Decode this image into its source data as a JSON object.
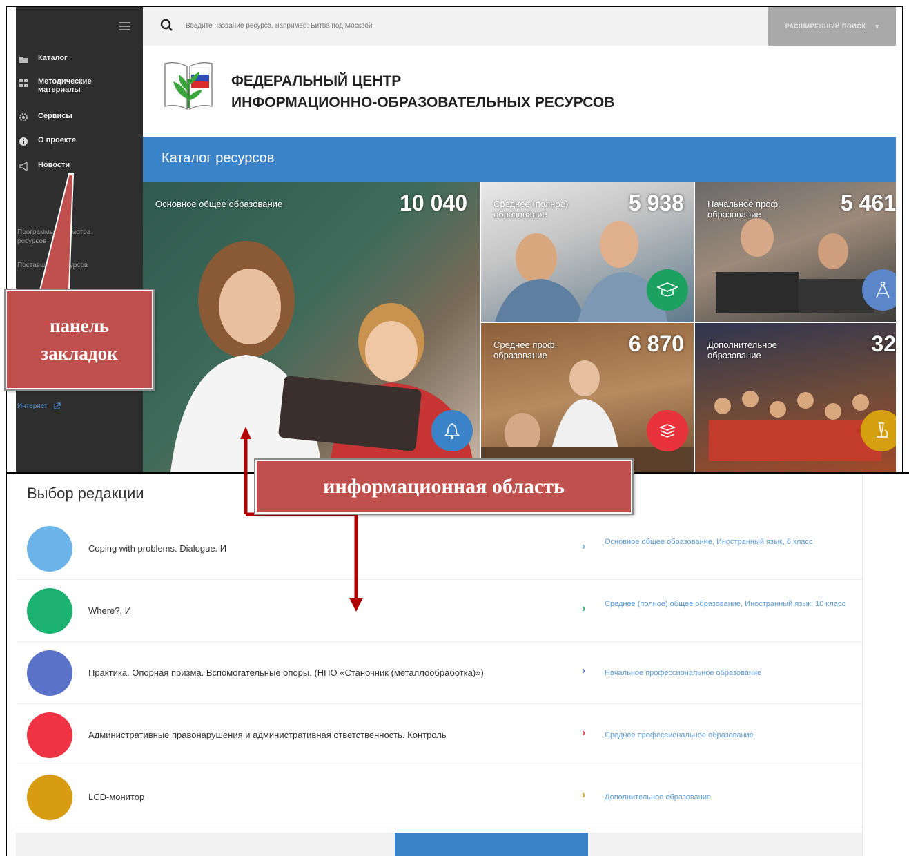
{
  "sidebar": {
    "items": [
      {
        "label": "Каталог",
        "icon": "folder-icon"
      },
      {
        "label": "Методические материалы",
        "icon": "grid-icon"
      },
      {
        "label": "Сервисы",
        "icon": "gear-icon"
      },
      {
        "label": "О проекте",
        "icon": "info-icon"
      },
      {
        "label": "Новости",
        "icon": "megaphone-icon"
      }
    ],
    "links": [
      "Программы просмотра ресурсов",
      "Поставщики ресурсов"
    ],
    "external_link": "Интернет"
  },
  "search": {
    "placeholder": "Введите название ресурса, например: Битва под Москвой",
    "advanced_label": "РАСШИРЕННЫЙ ПОИСК"
  },
  "header": {
    "title_line1": "ФЕДЕРАЛЬНЫЙ ЦЕНТР",
    "title_line2": "ИНФОРМАЦИОННО-ОБРАЗОВАТЕЛЬНЫХ РЕСУРСОВ"
  },
  "catalog": {
    "title": "Каталог ресурсов",
    "tiles": [
      {
        "label": "Основное общее образование",
        "count": "10 040",
        "color": "#3b83c8",
        "icon": "bell-icon"
      },
      {
        "label": "Среднее (полное) образование",
        "count": "5 938",
        "color": "#1ca160",
        "icon": "graduation-cap-icon"
      },
      {
        "label": "Начальное проф. образование",
        "count": "5 461",
        "color": "#5b86c9",
        "icon": "compass-icon"
      },
      {
        "label": "Среднее проф. образование",
        "count": "6 870",
        "color": "#e8323c",
        "icon": "books-icon"
      },
      {
        "label": "Дополнительное образование",
        "count": "32",
        "color": "#d4a010",
        "icon": "microscope-icon"
      }
    ]
  },
  "editor_choice": {
    "title": "Выбор редакции",
    "rows": [
      {
        "title": "Coping with problems. Dialogue. И",
        "category": "Основное общее образование, Иностранный язык, 6 класс",
        "color": "#6cb3ea"
      },
      {
        "title": "Where?. И",
        "category": "Среднее (полное) общее образование, Иностранный язык, 10 класс",
        "color": "#1db272"
      },
      {
        "title": "Практика. Опорная призма. Вспомогательные опоры. (НПО «Станочник (металлообработка)»)",
        "category": "Начальное профессиональное образование",
        "color": "#5b72c9"
      },
      {
        "title": "Административные правонарушения и административная ответственность. Контроль",
        "category": "Среднее профессиональное образование",
        "color": "#ef3344"
      },
      {
        "title": "LCD-монитор",
        "category": "Дополнительное образование",
        "color": "#d89c12"
      }
    ]
  },
  "annotations": {
    "bookmarks_panel": "панель закладок",
    "info_area": "информационная область"
  }
}
